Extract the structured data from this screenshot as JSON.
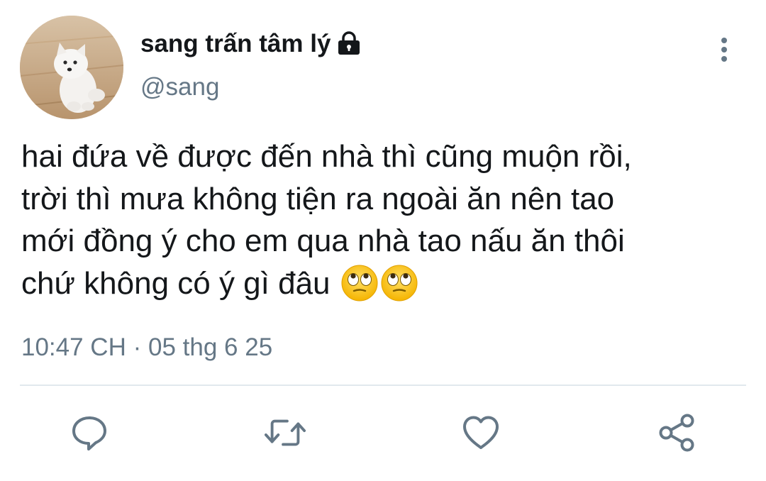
{
  "tweet": {
    "display_name": "sang trấn tâm lý",
    "handle": "@sang",
    "text_lines": [
      "hai đứa về được đến nhà thì cũng muộn rồi,",
      "trời thì mưa không tiện ra ngoài ăn nên tao",
      "mới đồng ý cho em qua nhà tao nấu ăn thôi",
      "chứ không có ý gì đâu"
    ],
    "emojis": [
      "face-with-rolling-eyes",
      "face-with-rolling-eyes"
    ],
    "time": "10:47 CH",
    "separator": "·",
    "date": "05 thg 6 25"
  },
  "icons": {
    "avatar": "white-puppy-photo",
    "protected": "lock-icon",
    "more": "vertical-dots-icon",
    "actions": [
      "reply-icon",
      "retweet-icon",
      "like-icon",
      "share-icon"
    ]
  },
  "colors": {
    "text_primary": "#14171a",
    "text_secondary": "#657786",
    "icon_gray": "#657786",
    "divider": "#e1e8ed"
  }
}
